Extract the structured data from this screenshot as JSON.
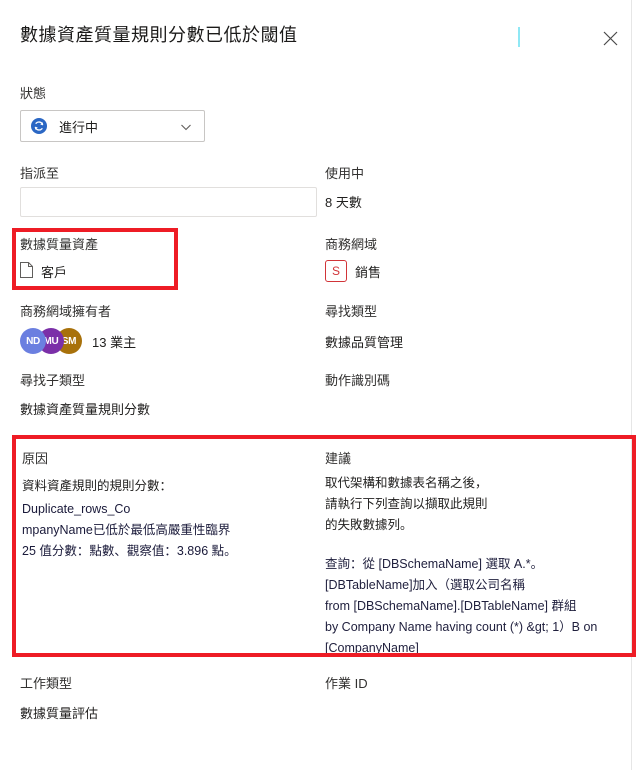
{
  "header": {
    "title": "數據資產質量規則分數已低於閾值",
    "close_icon": "close-icon"
  },
  "status": {
    "label": "狀態",
    "value": "進行中",
    "icon": "in-progress-sync-icon",
    "chevron": "chevron-down-icon"
  },
  "assigned_to": {
    "label": "指派至",
    "value": "",
    "placeholder": ""
  },
  "in_use": {
    "label": "使用中",
    "value": "8 天數"
  },
  "data_quality_asset": {
    "label": "數據質量資產",
    "value": "客戶",
    "icon": "document-icon"
  },
  "business_domain": {
    "label": "商務網域",
    "badge": "S",
    "value": "銷售"
  },
  "domain_owners": {
    "label": "商務網域擁有者",
    "avatars": [
      {
        "initials": "ND",
        "color": "#6b7fe0"
      },
      {
        "initials": "MU",
        "color": "#7b2fa8"
      },
      {
        "initials": "SM",
        "color": "#a8710b"
      }
    ],
    "caption": "13 業主"
  },
  "finding_type": {
    "label": "尋找類型",
    "value": "數據品質管理"
  },
  "finding_subtype": {
    "label": "尋找子類型",
    "value": "數據資產質量規則分數"
  },
  "action_id": {
    "label": "動作識別碼",
    "value": ""
  },
  "reason": {
    "label": "原因",
    "intro": "資料資產規則的規則分數：",
    "body": "Duplicate_rows_Co\nmpanyName已低於最低高嚴重性臨界\n25 值分數：點數、觀察值：3.896 點。"
  },
  "suggestion": {
    "label": "建議",
    "body": "取代架構和數據表名稱之後，\n請執行下列查詢以擷取此規則\n的失敗數據列。",
    "query": "查詢：從 [DBSchemaName] 選取 A.*。\n[DBTableName]加入（選取公司名稱\nfrom [DBSchemaName].[DBTableName] 群組\nby Company Name having count (*) &gt; 1）B on\n[CompanyName]"
  },
  "work_type": {
    "label": "工作類型",
    "value": "數據質量評估"
  },
  "job_id": {
    "label": "作業 ID",
    "value": ""
  },
  "colors": {
    "highlight_red": "#ee1c25",
    "accent_blue": "#0078d4",
    "badge_red": "#d13438"
  }
}
